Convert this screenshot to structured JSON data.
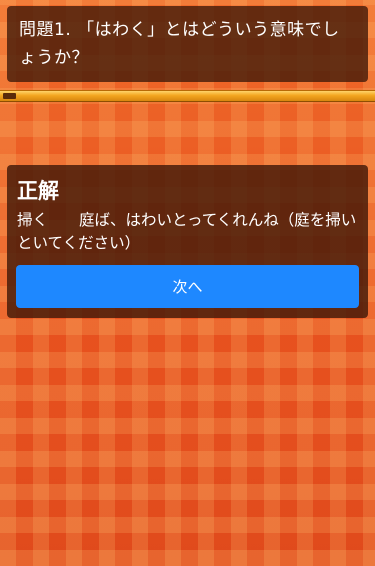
{
  "question": {
    "text": "問題1. 「はわく」とはどういう意味でしょうか？"
  },
  "progress": {
    "fraction": 0.035
  },
  "answer": {
    "heading": "正解",
    "explanation": "掃く　　庭ば、はわいとってくれんね（庭を掃いといてください）",
    "next_label": "次へ"
  }
}
